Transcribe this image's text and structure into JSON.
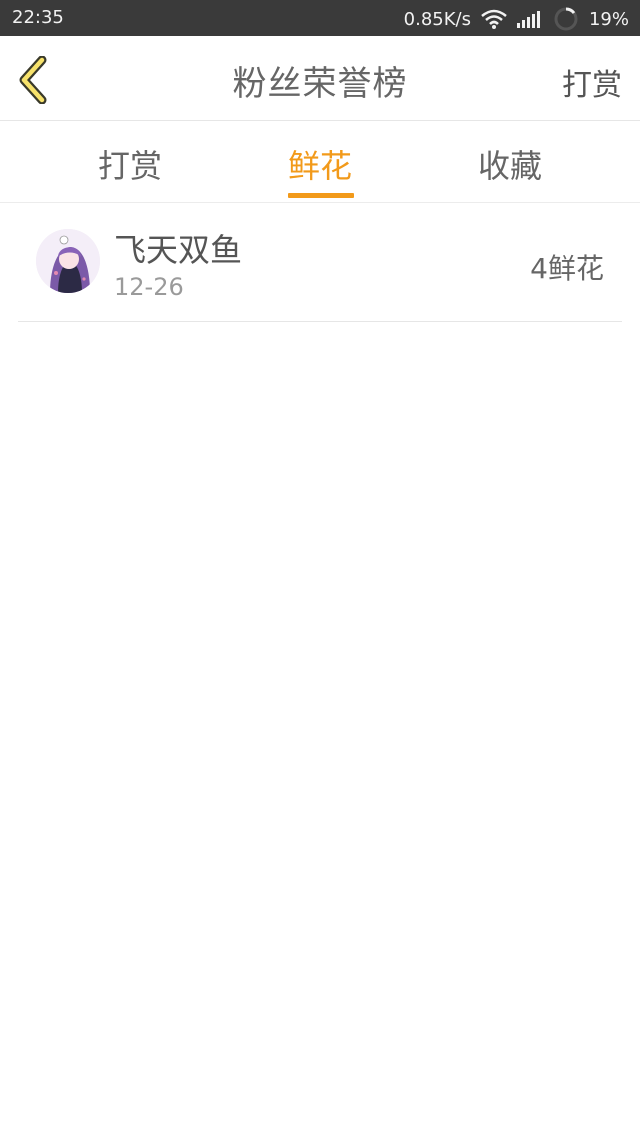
{
  "status_bar": {
    "time": "22:35",
    "net_speed": "0.85K/s",
    "battery": "19%",
    "icons": [
      "wifi-icon",
      "signal-icon",
      "battery-ring-icon"
    ]
  },
  "header": {
    "title": "粉丝荣誉榜",
    "action_label": "打赏",
    "back_icon": "chevron-left-icon"
  },
  "tabs": [
    {
      "label": "打赏",
      "active": false
    },
    {
      "label": "鲜花",
      "active": true
    },
    {
      "label": "收藏",
      "active": false
    }
  ],
  "list": [
    {
      "name": "飞天双鱼",
      "date": "12-26",
      "value": "4鲜花"
    }
  ],
  "colors": {
    "accent": "#f29a1a",
    "statusbar": "#3a3a3a",
    "text": "#555555",
    "muted": "#9a9a9a",
    "divider": "#e6e6e6"
  }
}
